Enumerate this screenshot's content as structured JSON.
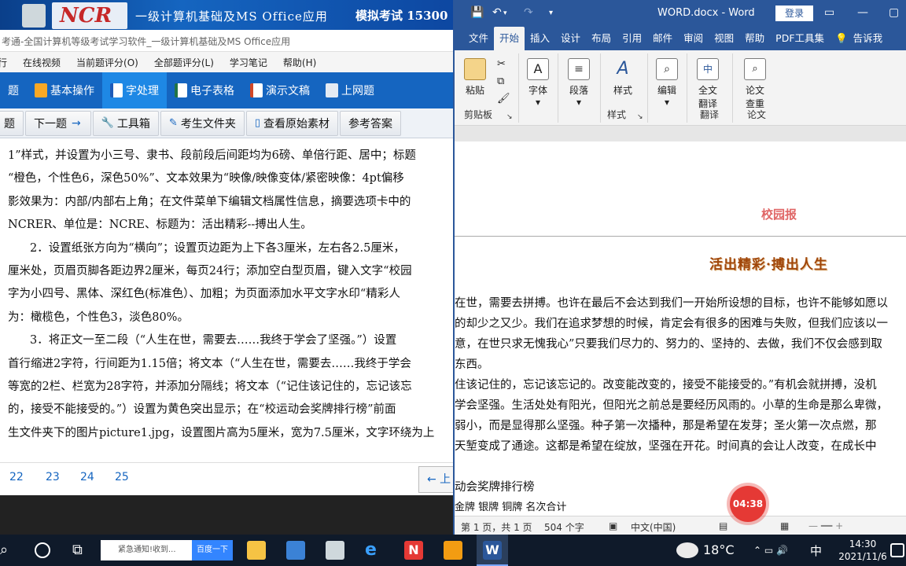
{
  "exam": {
    "banner": {
      "logo": "NCR",
      "title": "一级计算机基础及MS Office应用",
      "mock": "模拟考试 15300"
    },
    "window_title": "考通-全国计算机等级考试学习软件_一级计算机基础及MS Office应用",
    "menu": [
      "行",
      "在线视频",
      "当前题评分(O)",
      "全部题评分(L)",
      "学习笔记",
      "帮助(H)"
    ],
    "tabs": [
      "题",
      "基本操作",
      "字处理",
      "电子表格",
      "演示文稿",
      "上网题"
    ],
    "toolbar": {
      "prev": "题",
      "next": "下一题",
      "tools": "工具箱",
      "examinee_folder": "考生文件夹",
      "view_material": "查看原始素材",
      "answer": "参考答案"
    },
    "content_lines": [
      "1”样式，并设置为小三号、隶书、段前段后间距均为6磅、单倍行距、居中；标题",
      "“橙色，个性色6，深色50%”、文本效果为“映像/映像变体/紧密映像：4pt偏移",
      "影效果为：内部/内部右上角；在文件菜单下编辑文档属性信息，摘要选项卡中的",
      "NCRER、单位是：NCRE、标题为：活出精彩--搏出人生。",
      "2．设置纸张方向为“横向”；设置页边距为上下各3厘米，左右各2.5厘米，",
      "厘米处，页眉页脚各距边界2厘米，每页24行；添加空白型页眉，键入文字“校园",
      "字为小四号、黑体、深红色(标准色）、加粗；为页面添加水平文字水印“精彩人",
      "为：橄榄色，个性色3，淡色80%。",
      "3．将正文一至二段（“人生在世，需要去……我终于学会了坚强。”）设置",
      "首行缩进2字符，行间距为1.15倍；将文本（“人生在世，需要去……我终于学会",
      "等宽的2栏、栏宽为28字符，并添加分隔线；将文本（“记住该记住的，忘记该忘",
      "的，接受不能接受的。”）设置为黄色突出显示；在“校运动会奖牌排行榜”前面",
      "生文件夹下的图片picture1.jpg，设置图片高为5厘米，宽为7.5厘米，文字环绕为上"
    ],
    "pages": [
      "22",
      "23",
      "24",
      "25"
    ],
    "prev_page": "← 上"
  },
  "word": {
    "title": "WORD.docx  -  Word",
    "login": "登录",
    "tabs": [
      "文件",
      "开始",
      "插入",
      "设计",
      "布局",
      "引用",
      "邮件",
      "审阅",
      "视图",
      "帮助",
      "PDF工具集",
      "告诉我"
    ],
    "ribbon": {
      "paste": "粘贴",
      "clipboard": "剪贴板",
      "font": "字体",
      "paragraph": "段落",
      "styles": "样式",
      "styles_group": "样式",
      "edit": "编辑",
      "translate_line1": "全文",
      "translate_line2": "翻译",
      "translate_group": "翻译",
      "paper_line1": "论文",
      "paper_line2": "查重",
      "paper_group": "论文"
    },
    "doc": {
      "header": "校园报",
      "heading": "活出精彩·搏出人生",
      "lines": [
        "在世，需要去拼搏。也许在最后不会达到我们一开始所设想的目标，也许不能够如愿以",
        "的却少之又少。我们在追求梦想的时候，肯定会有很多的困难与失败，但我们应该以一",
        "意，在世只求无愧我心”只要我们尽力的、努力的、坚持的、去做，我们不仅会感到取",
        "东西。",
        "住该记住的，忘记该忘记的。改变能改变的，接受不能接受的。”有机会就拼搏，没机",
        "学会坚强。生活处处有阳光，但阳光之前总是要经历风雨的。小草的生命是那么卑微，",
        "弱小，而是显得那么坚强。种子第一次播种，那是希望在发芽；圣火第一次点燃，那",
        "天堑变成了通途。这都是希望在绽放，坚强在开花。时间真的会让人改变，在成长中",
        "动会奖牌排行榜",
        "金牌  银牌  铜牌  名次合计"
      ]
    },
    "status": {
      "page": "第 1 页，共 1 页",
      "words": "504 个字",
      "lang": "中文(中国)"
    }
  },
  "timer": "04:38",
  "taskbar": {
    "search_placeholder": "紧急通知!收到...",
    "baidu": "百度一下",
    "temp": "18°C",
    "ime": "中",
    "time": "14:30",
    "date": "2021/11/6"
  }
}
